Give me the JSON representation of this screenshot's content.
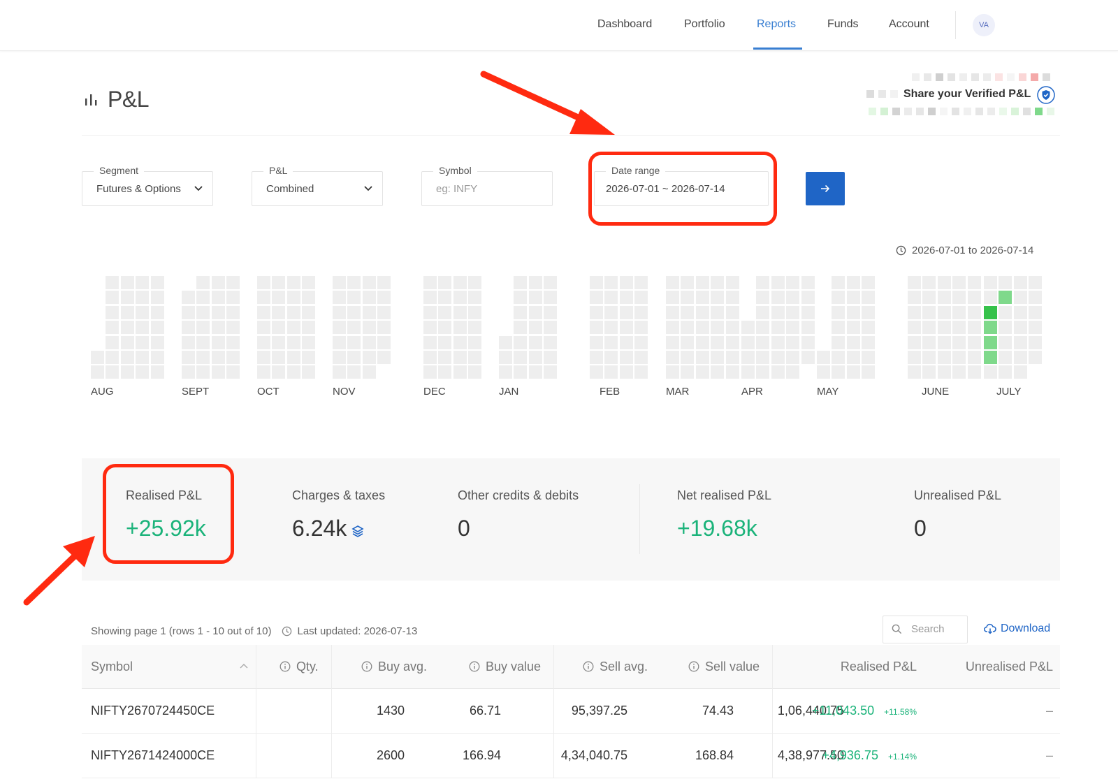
{
  "nav": {
    "items": [
      {
        "label": "Dashboard",
        "active": false
      },
      {
        "label": "Portfolio",
        "active": false
      },
      {
        "label": "Reports",
        "active": true
      },
      {
        "label": "Funds",
        "active": false
      },
      {
        "label": "Account",
        "active": false
      }
    ],
    "avatar": "VA",
    "accent_color": "#387ed1"
  },
  "header": {
    "title": "P&L",
    "title_icon": "bar-chart-icon",
    "share_label": "Share your Verified P&L",
    "share_icon": "shield-check-icon"
  },
  "filters": {
    "segment": {
      "label": "Segment",
      "value": "Futures & Options"
    },
    "pnl": {
      "label": "P&L",
      "value": "Combined"
    },
    "symbol": {
      "label": "Symbol",
      "placeholder": "eg: INFY"
    },
    "date_range": {
      "label": "Date range",
      "value": "2026-07-01 ~ 2026-07-14"
    },
    "submit_icon": "arrow-right-icon",
    "button_color": "#1f65c6"
  },
  "heatmap": {
    "range_text": "2026-07-01 to 2026-07-14",
    "months": [
      "AUG",
      "SEPT",
      "OCT",
      "NOV",
      "DEC",
      "JAN",
      "FEB",
      "MAR",
      "APR",
      "MAY",
      "JUNE",
      "JULY"
    ],
    "empty_color": "#eeeeee",
    "profit_colors": [
      "#36c24b",
      "#7fd98b"
    ]
  },
  "summary": {
    "realised": {
      "label": "Realised P&L",
      "value": "+25.92k"
    },
    "charges": {
      "label": "Charges & taxes",
      "value": "6.24k",
      "icon": "layers-icon"
    },
    "other": {
      "label": "Other credits & debits",
      "value": "0"
    },
    "net": {
      "label": "Net realised P&L",
      "value": "+19.68k"
    },
    "unrealised": {
      "label": "Unrealised P&L",
      "value": "0"
    },
    "profit_color": "#1bb37a"
  },
  "table_meta": {
    "showing": "Showing page 1 (rows 1 - 10 out of 10)",
    "last_updated": "Last updated: 2026-07-13",
    "search_placeholder": "Search",
    "download_label": "Download"
  },
  "table": {
    "columns": [
      "Symbol",
      "Qty.",
      "Buy avg.",
      "Buy value",
      "Sell avg.",
      "Sell value",
      "Realised P&L",
      "Unrealised P&L"
    ],
    "rows": [
      {
        "symbol": "NIFTY2670724450CE",
        "qty": "1430",
        "buy_avg": "66.71",
        "buy_value": "95,397.25",
        "sell_avg": "74.43",
        "sell_value": "1,06,440.75",
        "realised": "+11,043.50",
        "realised_pct": "+11.58%",
        "unrealised": "–"
      },
      {
        "symbol": "NIFTY2671424000CE",
        "qty": "2600",
        "buy_avg": "166.94",
        "buy_value": "4,34,040.75",
        "sell_avg": "168.84",
        "sell_value": "4,38,977.50",
        "realised": "+4,936.75",
        "realised_pct": "+1.14%",
        "unrealised": "–"
      }
    ]
  },
  "annotation_color": "#ff2a10"
}
